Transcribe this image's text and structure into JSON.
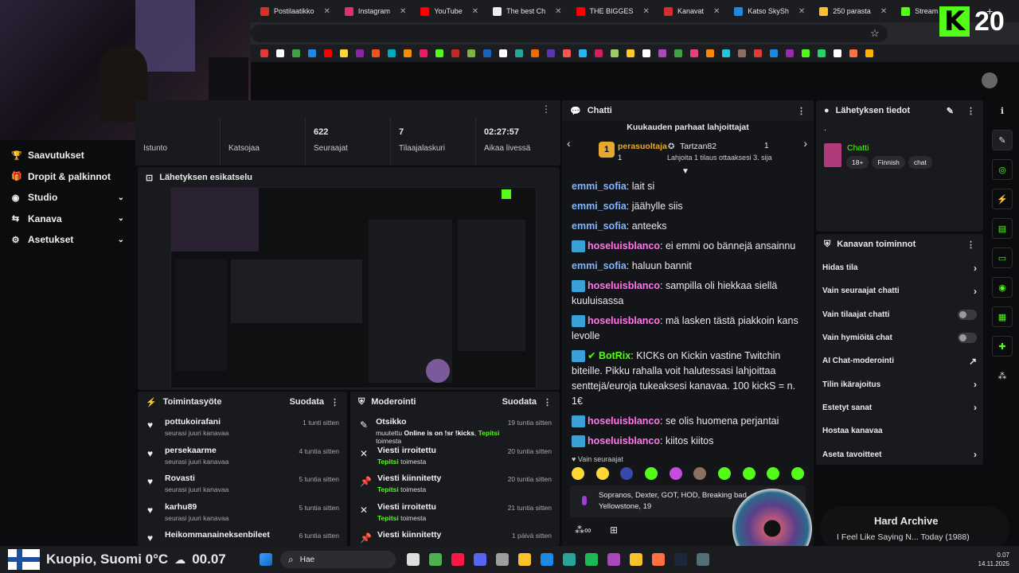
{
  "browser": {
    "tabs": [
      {
        "label": "Postilaatikko",
        "color": "#d93025"
      },
      {
        "label": "Instagram",
        "color": "#e1306c"
      },
      {
        "label": "YouTube",
        "color": "#ff0000"
      },
      {
        "label": "The best Ch",
        "color": "#eeeeee"
      },
      {
        "label": "THE BIGGES",
        "color": "#ff0000"
      },
      {
        "label": "Kanavat",
        "color": "#d32f2f"
      },
      {
        "label": "Katso SkySh",
        "color": "#1e88e5"
      },
      {
        "label": "250 parasta",
        "color": "#fbc02d"
      },
      {
        "label": "Stream - Kic",
        "color": "#53fc18"
      }
    ],
    "new_tab": "+"
  },
  "kick_badge": {
    "logo": "K",
    "count": "20"
  },
  "sidebar": {
    "items": [
      {
        "label": "Saavutukset",
        "icon": "trophy-icon",
        "glyph": "🏆"
      },
      {
        "label": "Dropit & palkinnot",
        "icon": "gift-icon",
        "glyph": "🎁"
      },
      {
        "label": "Studio",
        "icon": "studio-icon",
        "glyph": "◉"
      },
      {
        "label": "Kanava",
        "icon": "channel-icon",
        "glyph": "⇆"
      },
      {
        "label": "Asetukset",
        "icon": "gear-icon",
        "glyph": "⚙"
      }
    ]
  },
  "stats": [
    {
      "value": "",
      "label": "Istunto"
    },
    {
      "value": "",
      "label": "Katsojaa"
    },
    {
      "value": "622",
      "label": "Seuraajat"
    },
    {
      "value": "7",
      "label": "Tilaajalaskuri"
    },
    {
      "value": "02:27:57",
      "label": "Aikaa livessä"
    }
  ],
  "preview": {
    "title": "Lähetyksen esikatselu"
  },
  "activity": {
    "title": "Toimintasyöte",
    "filter": "Suodata",
    "items": [
      {
        "name": "pottukoirafani",
        "text": "seurasi juuri kanavaa",
        "time": "1 tunti sitten"
      },
      {
        "name": "persekaarme",
        "text": "seurasi juuri kanavaa",
        "time": "4 tuntia sitten"
      },
      {
        "name": "Rovasti",
        "text": "seurasi juuri kanavaa",
        "time": "5 tuntia sitten"
      },
      {
        "name": "karhu89",
        "text": "seurasi juuri kanavaa",
        "time": "5 tuntia sitten"
      },
      {
        "name": "Heikommanaineksenbileet",
        "text": "",
        "time": "6 tuntia sitten"
      }
    ]
  },
  "moderation": {
    "title": "Moderointi",
    "filter": "Suodata",
    "items": [
      {
        "title": "Otsikko",
        "who": "muutettu",
        "detail": "Online is on !sr !kicks",
        "by": "Tepitsi",
        "suffix": "toimesta",
        "time": "19 tuntia sitten",
        "icon": "user-edit-icon",
        "glyph": "✎"
      },
      {
        "title": "Viesti irroitettu",
        "who": "",
        "detail": "",
        "by": "Tepitsi",
        "suffix": "toimesta",
        "time": "20 tuntia sitten",
        "icon": "unpin-icon",
        "glyph": "✕"
      },
      {
        "title": "Viesti kiinnitetty",
        "who": "",
        "detail": "",
        "by": "Tepitsi",
        "suffix": "toimesta",
        "time": "20 tuntia sitten",
        "icon": "pin-icon",
        "glyph": "📌"
      },
      {
        "title": "Viesti irroitettu",
        "who": "",
        "detail": "",
        "by": "Tepitsi",
        "suffix": "toimesta",
        "time": "21 tuntia sitten",
        "icon": "unpin-icon",
        "glyph": "✕"
      },
      {
        "title": "Viesti kiinnitetty",
        "who": "",
        "detail": "",
        "by": "",
        "suffix": "",
        "time": "1 päivä sitten",
        "icon": "pin-icon",
        "glyph": "📌"
      }
    ]
  },
  "chat": {
    "title": "Chatti",
    "leaderboard_title": "Kuukauden parhaat lahjoittajat",
    "top1": {
      "rank": "1",
      "name": "perasuoltaja",
      "count": "1"
    },
    "top2": {
      "name": "Tartzan82",
      "count": "1"
    },
    "gift_hint": "Lahjoita 1 tilaus ottaaksesi 3. sija",
    "messages": [
      {
        "user": "emmi_sofia",
        "color": "#7fb6ff",
        "text": "lait si",
        "badge": false
      },
      {
        "user": "emmi_sofia",
        "color": "#7fb6ff",
        "text": "jäähylle siis",
        "badge": false
      },
      {
        "user": "emmi_sofia",
        "color": "#7fb6ff",
        "text": "anteeks",
        "badge": false
      },
      {
        "user": "hoseluisblanco",
        "color": "#ff77e9",
        "text": "ei emmi oo bännejä ansainnu",
        "badge": true
      },
      {
        "user": "emmi_sofia",
        "color": "#7fb6ff",
        "text": "haluun bannit",
        "badge": false
      },
      {
        "user": "hoseluisblanco",
        "color": "#ff77e9",
        "text": "sampilla oli hiekkaa siellä kuuluisassa",
        "badge": true
      },
      {
        "user": "hoseluisblanco",
        "color": "#ff77e9",
        "text": "mä lasken tästä piakkoin kans levolle",
        "badge": true
      },
      {
        "user": "BotRix",
        "color": "#53fc18",
        "text": "KICKs on Kickin vastine Twitchin biteille. Pikku rahalla voit halutessasi lahjoittaa senttejä/euroja tukeaksesi kanavaa. 100 kickS = n. 1€",
        "badge": true
      },
      {
        "user": "hoseluisblanco",
        "color": "#ff77e9",
        "text": "se olis huomena perjantai",
        "badge": true
      },
      {
        "user": "hoseluisblanco",
        "color": "#ff77e9",
        "text": "kiitos kiitos",
        "badge": true
      }
    ],
    "followers_only": "Vain seuraajat",
    "input_value": "Sopranos, Dexter, GOT, HOD, Breaking bad, Yellowstone, 19"
  },
  "info": {
    "title": "Lähetyksen tiedot",
    "dot": ".",
    "category": "Chatti",
    "tags": [
      "18+",
      "Finnish",
      "chat"
    ]
  },
  "channel_tools": {
    "title": "Kanavan toiminnot",
    "items": [
      {
        "label": "Hidas tila",
        "control": "chevron"
      },
      {
        "label": "Vain seuraajat chatti",
        "control": "chevron"
      },
      {
        "label": "Vain tilaajat chatti",
        "control": "toggle"
      },
      {
        "label": "Vain hymiöitä chat",
        "control": "toggle"
      },
      {
        "label": "AI Chat-moderointi",
        "control": "external"
      },
      {
        "label": "Tilin ikärajoitus",
        "control": "chevron"
      },
      {
        "label": "Estetyt sanat",
        "control": "chevron"
      },
      {
        "label": "Hostaa kanavaa",
        "control": "none"
      },
      {
        "label": "Aseta tavoitteet",
        "control": "chevron"
      }
    ]
  },
  "now_playing": {
    "artist": "Hard Archive",
    "song": "I Feel Like Saying N... Today (1988)"
  },
  "overlay": {
    "location": "Kuopio, Suomi 0°C",
    "time": "00.07"
  },
  "taskbar": {
    "search": "Hae",
    "clock": "0.07",
    "date": "14.11.2025"
  }
}
